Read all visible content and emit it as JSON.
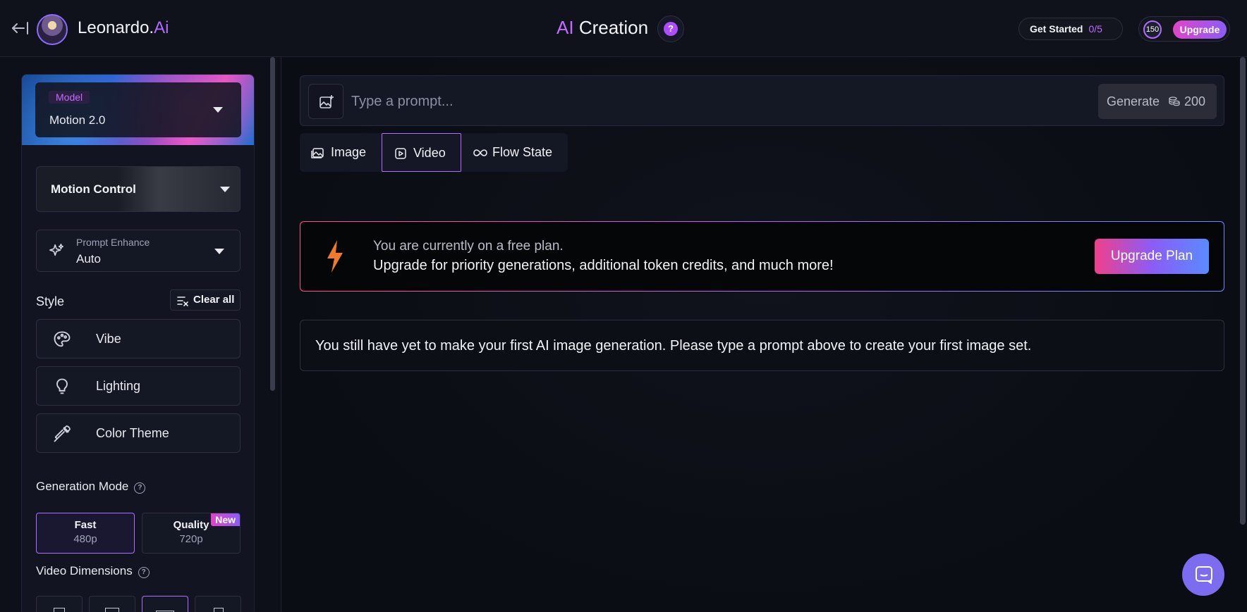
{
  "header": {
    "brand_main": "Leonardo.",
    "brand_accent": "Ai",
    "title_accent": "AI",
    "title_main": "Creation",
    "help_label": "?",
    "get_started_label": "Get Started",
    "get_started_progress": "0/5",
    "token_count": "150",
    "upgrade_label": "Upgrade"
  },
  "sidebar": {
    "model_label": "Model",
    "model_value": "Motion 2.0",
    "motion_control_label": "Motion Control",
    "prompt_enhance_label": "Prompt Enhance",
    "prompt_enhance_value": "Auto",
    "style_heading": "Style",
    "clear_all_label": "Clear all",
    "style_items": [
      {
        "label": "Vibe",
        "icon": "palette-icon"
      },
      {
        "label": "Lighting",
        "icon": "lightbulb-icon"
      },
      {
        "label": "Color Theme",
        "icon": "eyedropper-icon"
      }
    ],
    "generation_mode_heading": "Generation Mode",
    "modes": [
      {
        "title": "Fast",
        "subtitle": "480p",
        "active": true
      },
      {
        "title": "Quality",
        "subtitle": "720p",
        "badge": "New",
        "active": false
      }
    ],
    "video_dimensions_heading": "Video Dimensions"
  },
  "main": {
    "prompt_placeholder": "Type a prompt...",
    "generate_label": "Generate",
    "generate_cost": "200",
    "tabs": [
      {
        "label": "Image",
        "icon": "image-icon"
      },
      {
        "label": "Video",
        "icon": "video-icon",
        "active": true
      },
      {
        "label": "Flow State",
        "icon": "infinity-icon"
      }
    ],
    "free_plan_line1": "You are currently on a free plan.",
    "free_plan_line2": "Upgrade for priority generations, additional token credits, and much more!",
    "upgrade_plan_label": "Upgrade Plan",
    "empty_message": "You still have yet to make your first AI image generation. Please type a prompt above to create your first image set."
  },
  "colors": {
    "accent": "#b06cff",
    "background": "#0b0d14",
    "upgrade_gradient_start": "#f0408a",
    "upgrade_gradient_end": "#5a8bff"
  }
}
